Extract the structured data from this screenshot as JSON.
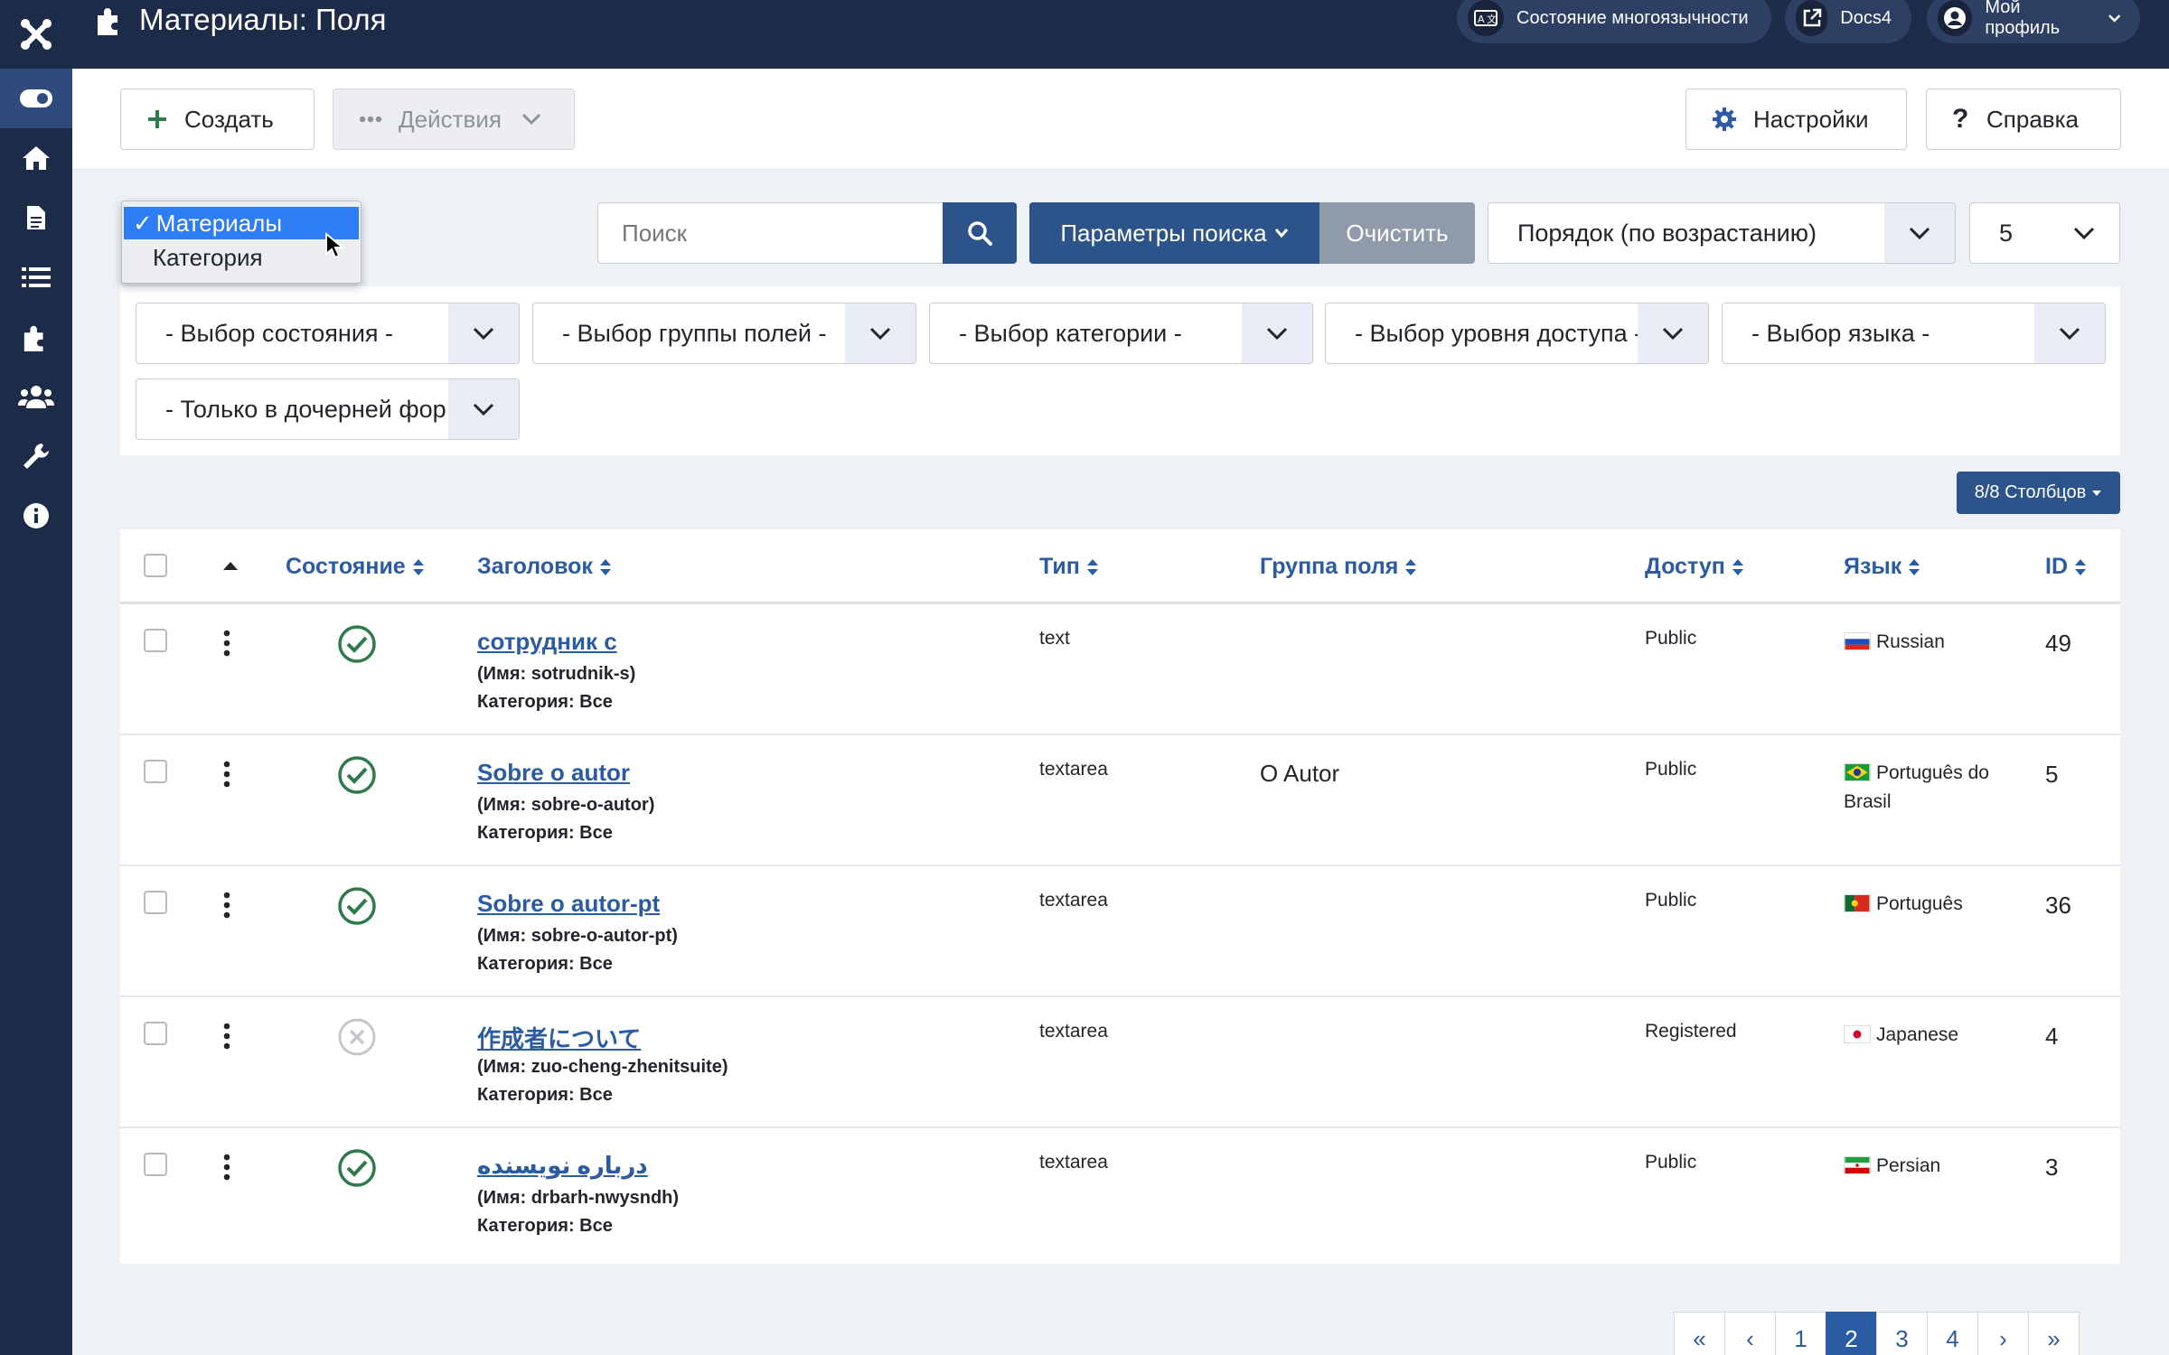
{
  "header": {
    "title": "Материалы: Поля",
    "multilang_label": "Состояние многоязычности",
    "docs_label": "Docs4",
    "profile_label": "Мой профиль"
  },
  "toolbar": {
    "create_label": "Создать",
    "actions_label": "Действия",
    "options_label": "Настройки",
    "help_label": "Справка"
  },
  "context_select": {
    "options": [
      "Материалы",
      "Категория"
    ],
    "selected_index": 0,
    "selected_mark": "✓"
  },
  "search": {
    "placeholder": "Поиск",
    "tools_label": "Параметры поиска",
    "clear_label": "Очистить",
    "ordering": "Порядок (по возрастанию)",
    "limit": "5"
  },
  "filters": {
    "state": "- Выбор состояния -",
    "group": "- Выбор группы полей -",
    "category": "- Выбор категории -",
    "access": "- Выбор уровня доступа -",
    "language": "- Выбор языка -",
    "context": "- Только в дочерней фор"
  },
  "columns_button": "8/8 Столбцов",
  "table": {
    "headers": {
      "state": "Состояние",
      "title": "Заголовок",
      "type": "Тип",
      "group": "Группа поля",
      "access": "Доступ",
      "language": "Язык",
      "id": "ID"
    },
    "rows": [
      {
        "title": "сотрудник с",
        "alias": "(Имя: sotrudnik-s)",
        "category": "Категория: Все",
        "type": "text",
        "group": "",
        "access": "Public",
        "language": "Russian",
        "flag": "ru",
        "id": "49",
        "published": true
      },
      {
        "title": "Sobre o autor",
        "alias": "(Имя: sobre-o-autor)",
        "category": "Категория: Все",
        "type": "textarea",
        "group": "O Autor",
        "access": "Public",
        "language": "Português do Brasil",
        "flag": "br",
        "id": "5",
        "published": true
      },
      {
        "title": "Sobre o autor-pt",
        "alias": "(Имя: sobre-o-autor-pt)",
        "category": "Категория: Все",
        "type": "textarea",
        "group": "",
        "access": "Public",
        "language": "Português",
        "flag": "pt",
        "id": "36",
        "published": true
      },
      {
        "title": "作成者について",
        "alias": "(Имя: zuo-cheng-zhenitsuite)",
        "category": "Категория: Все",
        "type": "textarea",
        "group": "",
        "access": "Registered",
        "language": "Japanese",
        "flag": "jp",
        "id": "4",
        "published": false
      },
      {
        "title": "درباره نویسنده",
        "alias": "(Имя: drbarh-nwysndh)",
        "category": "Категория: Все",
        "type": "textarea",
        "group": "",
        "access": "Public",
        "language": "Persian",
        "flag": "ir",
        "id": "3",
        "published": true
      }
    ]
  },
  "pagination": {
    "first": "«",
    "prev": "‹",
    "pages": [
      "1",
      "2",
      "3",
      "4"
    ],
    "current": "2",
    "next": "›",
    "last": "»"
  },
  "colors": {
    "sidebar": "#1c2b47",
    "accent": "#2a5ba3",
    "published": "#2f7a4a"
  }
}
